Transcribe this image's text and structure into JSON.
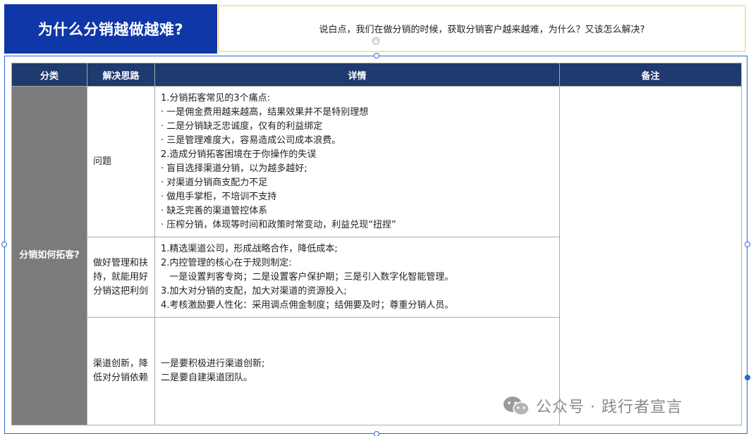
{
  "header": {
    "title": "为什么分销越做越难?",
    "subtitle": "说白点，我们在做分销的时候，获取分销客户越来越难，为什么？又该怎么解决?"
  },
  "table": {
    "headers": [
      "分类",
      "解决思路",
      "详情",
      "备注"
    ],
    "category": "分销如何拓客?",
    "rows": [
      {
        "approach": "问题",
        "details": [
          "1.分销拓客常见的3个痛点:",
          "· 一是佣金费用越来越高，结果效果并不是特别理想",
          "· 二是分销缺乏忠诚度，仅有的利益绑定",
          "· 三是管理难度大，容易造成公司成本浪费。",
          "2.造成分销拓客困境在于你操作的失误",
          "· 盲目选择渠道分销，以为越多越好;",
          "· 对渠道分销商支配力不足",
          "· 做甩手掌柜，不培训不支持",
          "· 缺乏完善的渠道管控体系",
          "· 压榨分销，体现等时间和政策时常变动，利益兑现“扭捏”"
        ],
        "note": ""
      },
      {
        "approach": "做好管理和扶持，就能用好分销这把利剑",
        "details": [
          "1.精选渠道公司，形成战略合作，降低成本;",
          "2.内控管理的核心在于规则制定:",
          "   一是设置判客专岗；二是设置客户保护期；三是引入数字化智能管理。",
          "3.加大对分销的支配，加大对渠道的资源投入;",
          "4.考核激励要人性化：采用调点佣金制度；结佣要及时；尊重分销人员。"
        ],
        "note": ""
      },
      {
        "approach": "渠道创新，降低对分销依赖",
        "details": [
          "一是要积极进行渠道创新;",
          "二是要自建渠道团队。"
        ],
        "note": ""
      }
    ]
  },
  "watermark": {
    "text": "公众号 · 践行者宣言",
    "icon": "wechat-icon"
  },
  "colors": {
    "title_bg": "#0f37a8",
    "header_bg": "#1e3a6e",
    "category_bg": "#7b7b7b",
    "frame_border": "#2f66d0",
    "subtitle_border": "#f3e6ad"
  }
}
